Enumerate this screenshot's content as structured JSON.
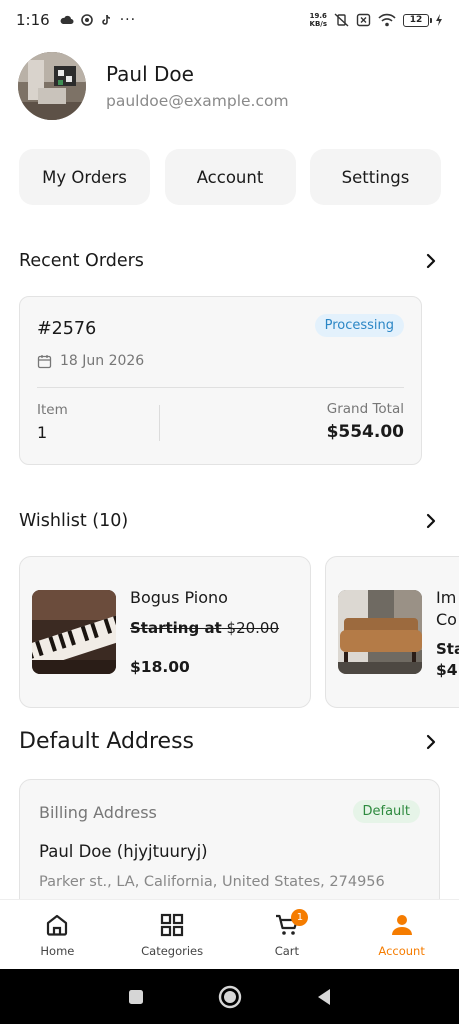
{
  "status_bar": {
    "time": "1:16",
    "net_speed_value": "19.6",
    "net_speed_unit": "KB/s",
    "battery": "12"
  },
  "profile": {
    "name": "Paul Doe",
    "email": "pauldoe@example.com"
  },
  "quick_actions": [
    "My Orders",
    "Account",
    "Settings"
  ],
  "recent_orders": {
    "title": "Recent Orders",
    "order": {
      "id": "#2576",
      "status": "Processing",
      "date": "18 Jun 2026",
      "item_label": "Item",
      "item_value": "1",
      "total_label": "Grand Total",
      "total_value": "$554.00"
    }
  },
  "wishlist": {
    "title": "Wishlist (10)",
    "items": [
      {
        "name": "Bogus Piono",
        "old_prefix": "Starting at",
        "old_price": "$20.00",
        "price": "$18.00"
      },
      {
        "name": "Im",
        "name2": "Co",
        "old_prefix": "Sta",
        "price": "$4"
      }
    ]
  },
  "address": {
    "title": "Default Address",
    "type": "Billing Address",
    "badge": "Default",
    "name": "Paul Doe (hjyjtuuryj)",
    "line": "Parker st., LA, California, United States, 274956"
  },
  "bottom_nav": {
    "items": [
      "Home",
      "Categories",
      "Cart",
      "Account"
    ],
    "cart_count": "1",
    "active": "Account",
    "accent": "#f57c00"
  }
}
